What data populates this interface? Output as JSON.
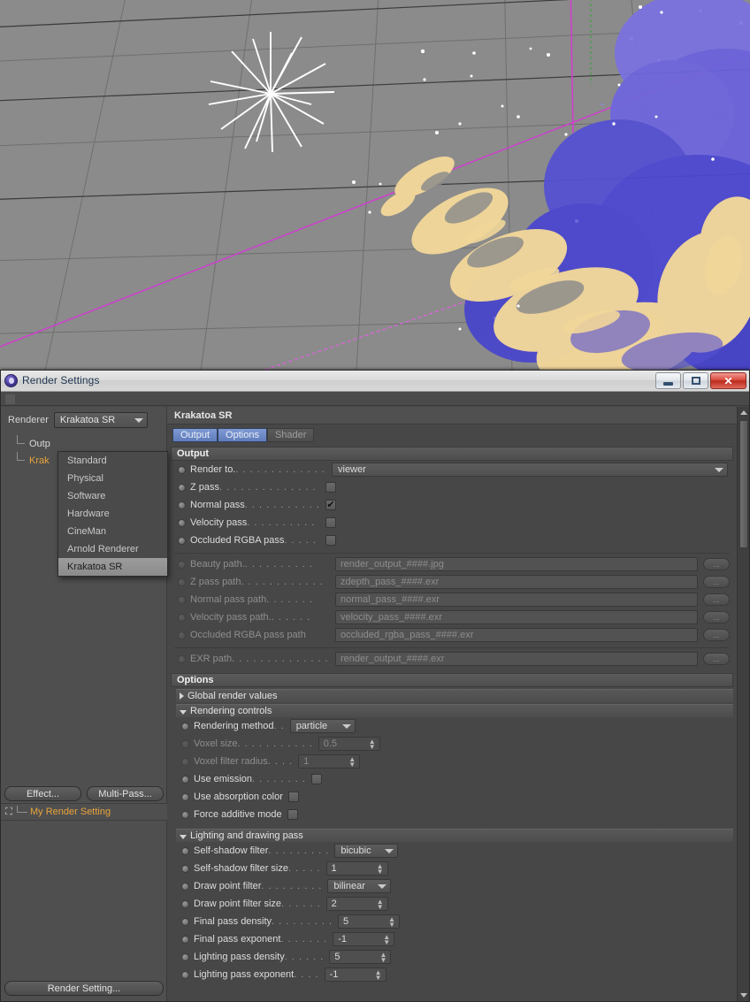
{
  "window": {
    "title": "Render Settings",
    "icon": "cinema4d-icon",
    "buttons": {
      "minimize": "minimize-icon",
      "maximize": "maximize-icon",
      "close": "✕"
    }
  },
  "left_panel": {
    "renderer_label": "Renderer",
    "renderer_value": "Krakatoa SR",
    "renderer_options": [
      {
        "label": "Standard",
        "selected": false
      },
      {
        "label": "Physical",
        "selected": false
      },
      {
        "label": "Software",
        "selected": false
      },
      {
        "label": "Hardware",
        "selected": false
      },
      {
        "label": "CineMan",
        "selected": false
      },
      {
        "label": "Arnold Renderer",
        "selected": false
      },
      {
        "label": "Krakatoa SR",
        "selected": true
      }
    ],
    "tree": [
      {
        "label": "Outp",
        "selected": false
      },
      {
        "label": "Krak",
        "selected": true
      }
    ],
    "effect_button": "Effect...",
    "multipass_button": "Multi-Pass...",
    "setting_name": "My Render Setting",
    "setting_icon": "render-active-icon",
    "render_setting_button": "Render Setting..."
  },
  "right_panel": {
    "header": "Krakatoa SR",
    "tabs": [
      {
        "label": "Output",
        "active": true
      },
      {
        "label": "Options",
        "active": true
      },
      {
        "label": "Shader",
        "active": false
      }
    ],
    "output_section": "Output",
    "output_rows": [
      {
        "label": "Render to.",
        "dots": ". . . . . . . . . . . . .",
        "type": "dropdown",
        "value": "viewer",
        "disabled": false
      },
      {
        "label": "Z pass",
        "dots": ". . . . . . . . . . . . . .",
        "type": "checkbox",
        "checked": false,
        "disabled": false
      },
      {
        "label": "Normal pass",
        "dots": ". . . . . . . . . . .",
        "type": "checkbox",
        "checked": true,
        "disabled": false
      },
      {
        "label": "Velocity pass",
        "dots": ". . . . . . . . . .",
        "type": "checkbox",
        "checked": false,
        "disabled": false
      },
      {
        "label": "Occluded RGBA pass",
        "dots": ". . . . .",
        "type": "checkbox",
        "checked": false,
        "disabled": false
      }
    ],
    "path_rows": [
      {
        "label": "Beauty path.",
        "dots": ". . . . . . . . . .",
        "value": "render_output_####.jpg",
        "button": "...",
        "disabled": true
      },
      {
        "label": "Z pass path",
        "dots": ". . . . . . . . . . . .",
        "value": "zdepth_pass_####.exr",
        "button": "...",
        "disabled": true
      },
      {
        "label": "Normal pass path",
        "dots": ". . . . . . .",
        "value": "normal_pass_####.exr",
        "button": "...",
        "disabled": true
      },
      {
        "label": "Velocity pass path.",
        "dots": ". . . . . .",
        "value": "velocity_pass_####.exr",
        "button": "...",
        "disabled": true
      },
      {
        "label": "Occluded RGBA pass path",
        "dots": "",
        "value": "occluded_rgba_pass_####.exr",
        "button": "...",
        "disabled": true
      }
    ],
    "exr_row": {
      "label": "EXR path",
      "dots": ". . . . . . . . . . . . . .",
      "value": "render_output_####.exr",
      "button": "...",
      "disabled": true
    },
    "options_section": "Options",
    "group_global": {
      "label": "Global render values",
      "open": false
    },
    "group_rendering": {
      "label": "Rendering controls",
      "open": true
    },
    "rendering_rows": [
      {
        "label": "Rendering method",
        "dots": ". .",
        "type": "dropdown",
        "value": "particle",
        "disabled": false
      },
      {
        "label": "Voxel size",
        "dots": ". . . . . . . . . . .",
        "type": "spin",
        "value": "0.5",
        "disabled": true
      },
      {
        "label": "Voxel filter radius",
        "dots": ". . . .",
        "type": "spin",
        "value": "1",
        "disabled": true
      },
      {
        "label": "Use emission",
        "dots": ". . . . . . . .",
        "type": "checkbox",
        "checked": false,
        "disabled": false
      },
      {
        "label": "Use absorption color",
        "dots": "",
        "type": "checkbox",
        "checked": false,
        "disabled": false
      },
      {
        "label": "Force additive mode",
        "dots": "",
        "type": "checkbox",
        "checked": false,
        "disabled": false
      }
    ],
    "group_lighting": {
      "label": "Lighting and drawing pass",
      "open": true
    },
    "lighting_rows": [
      {
        "label": "Self-shadow filter",
        "dots": ". . . . . . . . .",
        "type": "dropdown",
        "value": "bicubic",
        "disabled": false
      },
      {
        "label": "Self-shadow filter size",
        "dots": ". . . . .",
        "type": "spin",
        "value": "1",
        "disabled": false
      },
      {
        "label": "Draw point filter",
        "dots": ". . . . . . . . .",
        "type": "dropdown",
        "value": "bilinear",
        "disabled": false
      },
      {
        "label": "Draw point filter size",
        "dots": ". . . . . .",
        "type": "spin",
        "value": "2",
        "disabled": false
      },
      {
        "label": "Final pass density",
        "dots": ". . . . . . . . .",
        "type": "spin",
        "value": "5",
        "disabled": false
      },
      {
        "label": "Final pass exponent",
        "dots": ". . . . . . .",
        "type": "spin",
        "value": "-1",
        "disabled": false
      },
      {
        "label": "Lighting pass density",
        "dots": ". . . . . .",
        "type": "spin",
        "value": "5",
        "disabled": false
      },
      {
        "label": "Lighting pass exponent",
        "dots": ". . . .",
        "type": "spin",
        "value": "-1",
        "disabled": false
      }
    ]
  },
  "viewport": {
    "description": "3D particle simulation viewport with perspective grid",
    "background_color": "#8b8b8b",
    "grid_color": "#6f6f6f",
    "particle_colors": [
      "#5a5ad8",
      "#7a6fdd",
      "#f2d79a",
      "#ffffff"
    ],
    "axis_colors": {
      "x": "#cf3fcf",
      "y": "#4f9b4f",
      "z": "#3a3a3a"
    },
    "light_gizmo": "omni-light-icon"
  }
}
